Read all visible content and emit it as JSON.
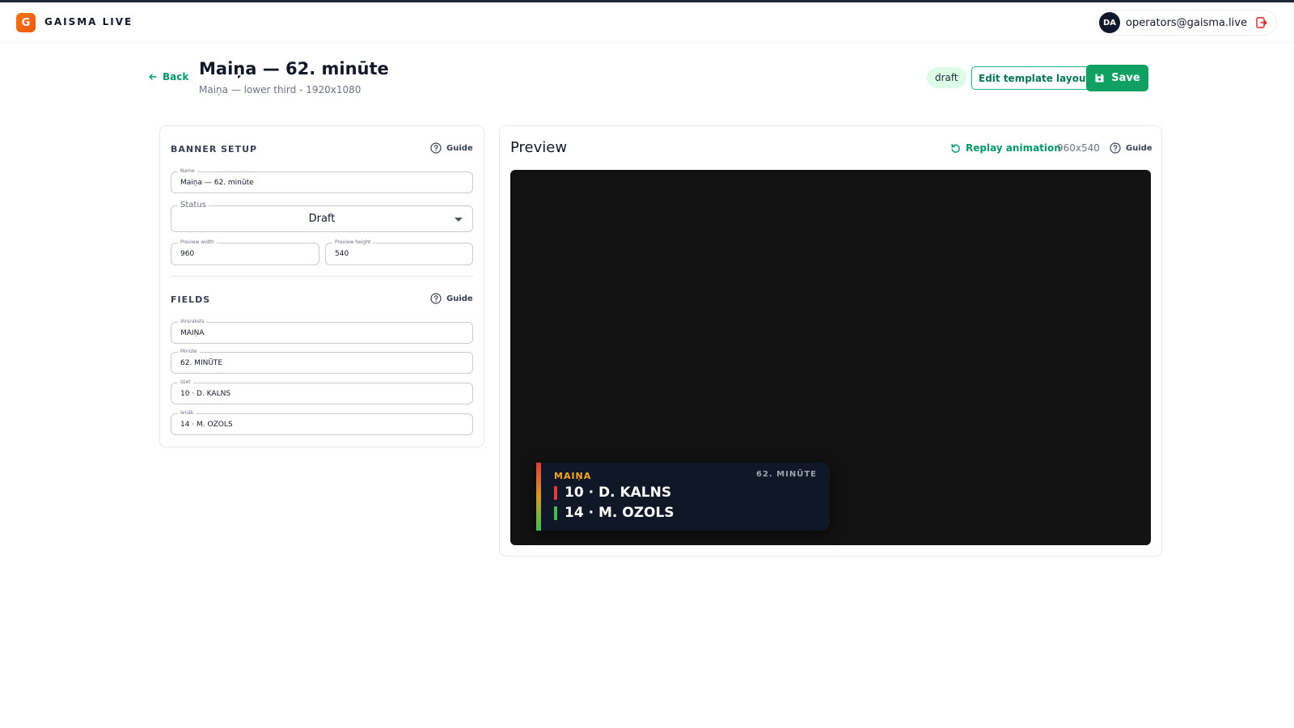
{
  "app": {
    "brand": "GAISMA LIVE",
    "logo_letter": "G"
  },
  "user": {
    "initials": "DA",
    "email": "operators@gaisma.live"
  },
  "header": {
    "back_label": "Back",
    "title": "Maiņa — 62. minūte",
    "subtitle": "Maiņa — lower third - 1920x1080",
    "status_chip": "draft",
    "edit_label": "Edit template layout",
    "save_label": "Save"
  },
  "setup": {
    "title": "BANNER SETUP",
    "guide": "Guide",
    "name": {
      "label": "Name",
      "value": "Maiņa — 62. minūte"
    },
    "status": {
      "label": "Status",
      "value": "Draft"
    },
    "preview_width": {
      "label": "Preview width",
      "value": "960"
    },
    "preview_height": {
      "label": "Preview height",
      "value": "540"
    }
  },
  "fields": {
    "title": "FIELDS",
    "guide": "Guide",
    "items": [
      {
        "label": "Virsraksts",
        "value": "MAIŅA"
      },
      {
        "label": "Minūte",
        "value": "62. MINŪTE"
      },
      {
        "label": "Iziet",
        "value": "10 · D. KALNS"
      },
      {
        "label": "Ienāk",
        "value": "14 · M. OZOLS"
      }
    ]
  },
  "preview": {
    "title": "Preview",
    "replay_label": "Replay animation",
    "dims": "960x540",
    "guide": "Guide"
  },
  "banner": {
    "headline": "MAIŅA",
    "minute": "62. MINŪTE",
    "out_player": "10 · D. KALNS",
    "in_player": "14 · M. OZOLS",
    "colors": {
      "out": "#e23b3b",
      "in": "#3fbf53",
      "headline": "#f5a623"
    }
  },
  "colors": {
    "accent": "#10a061",
    "logo": "#f97316"
  }
}
